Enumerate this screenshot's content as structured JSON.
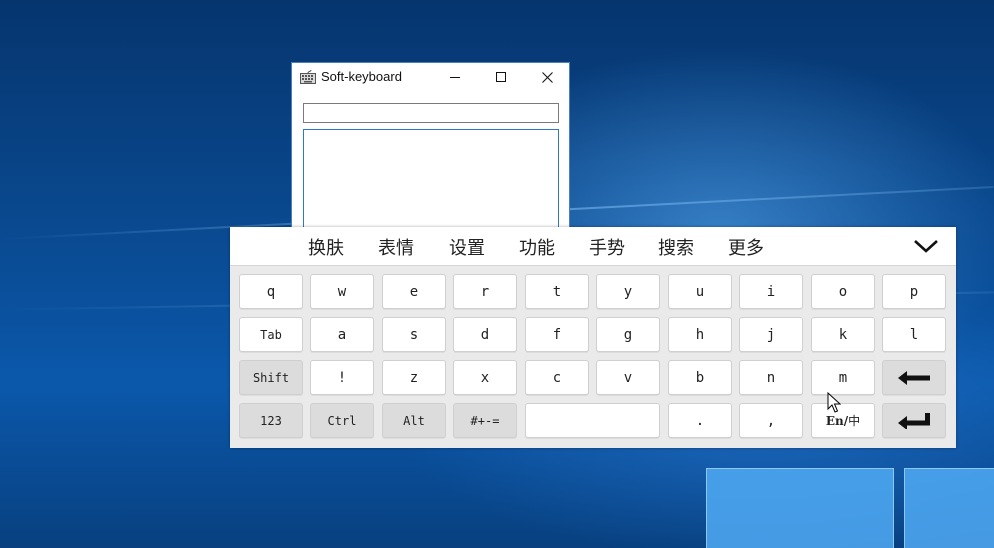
{
  "window": {
    "title": "Soft-keyboard",
    "single_input_value": "",
    "multi_input_value": ""
  },
  "keyboard": {
    "toolbar": [
      "换肤",
      "表情",
      "设置",
      "功能",
      "手势",
      "搜索",
      "更多"
    ],
    "rows": [
      [
        "q",
        "w",
        "e",
        "r",
        "t",
        "y",
        "u",
        "i",
        "o",
        "p"
      ],
      [
        "Tab",
        "a",
        "s",
        "d",
        "f",
        "g",
        "h",
        "j",
        "k",
        "l"
      ],
      [
        "Shift",
        "!",
        "z",
        "x",
        "c",
        "v",
        "b",
        "n",
        "m",
        ""
      ],
      [
        "123",
        "Ctrl",
        "Alt",
        "#+-=",
        "",
        ".",
        ",",
        "En/中",
        ""
      ]
    ],
    "lang_en": "En",
    "lang_sep": "/",
    "lang_cn": "中"
  },
  "icons": {
    "app": "keyboard-icon",
    "minimize": "minimize-icon",
    "maximize": "maximize-icon",
    "close": "close-icon",
    "collapse": "chevron-down-icon",
    "backspace": "backspace-arrow-icon",
    "enter": "enter-arrow-icon"
  },
  "colors": {
    "window_border": "#4a7fc0",
    "input_focus_border": "#2b7bbd",
    "key_bg": "#ffffff",
    "function_key_bg": "#dcdcdc",
    "keyboard_bg": "#eaeaea"
  }
}
